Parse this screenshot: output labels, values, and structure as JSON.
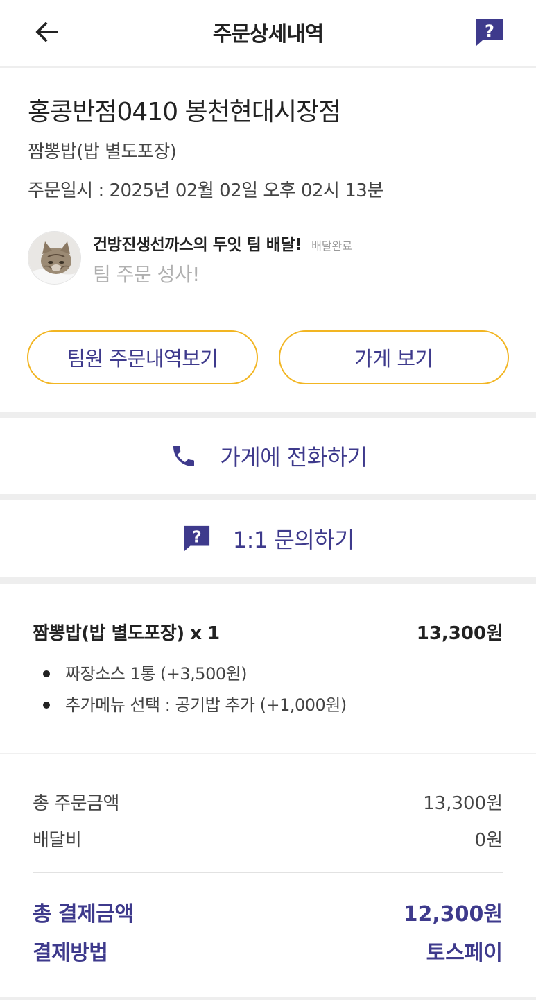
{
  "header": {
    "title": "주문상세내역",
    "back_icon": "arrow-left-icon",
    "help_icon": "question-bubble-icon"
  },
  "order": {
    "store_name": "홍콩반점0410 봉천현대시장점",
    "menu_summary": "짬뽕밥(밥 별도포장)",
    "order_date": "주문일시 : 2025년 02월 02일 오후 02시 13분"
  },
  "team": {
    "name": "건방진생선까스의 두잇 팀 배달!",
    "status": "배달완료",
    "message": "팀 주문 성사!"
  },
  "buttons": {
    "team_orders": "팀원 주문내역보기",
    "view_store": "가게 보기"
  },
  "actions": {
    "call_store": "가게에 전화하기",
    "call_icon": "phone-icon",
    "inquiry": "1:1 문의하기",
    "inquiry_icon": "question-bubble-icon"
  },
  "item": {
    "name": "짬뽕밥(밥 별도포장) x 1",
    "price": "13,300원",
    "options": [
      "짜장소스 1통 (+3,500원)",
      "추가메뉴 선택 : 공기밥 추가 (+1,000원)"
    ]
  },
  "summary": {
    "total_order_label": "총 주문금액",
    "total_order_value": "13,300원",
    "delivery_fee_label": "배달비",
    "delivery_fee_value": "0원",
    "payment_total_label": "총 결제금액",
    "payment_total_value": "12,300원",
    "payment_method_label": "결제방법",
    "payment_method_value": "토스페이"
  },
  "colors": {
    "accent": "#3e3a8c",
    "button_border": "#f2b522",
    "divider": "#eeeeee"
  }
}
